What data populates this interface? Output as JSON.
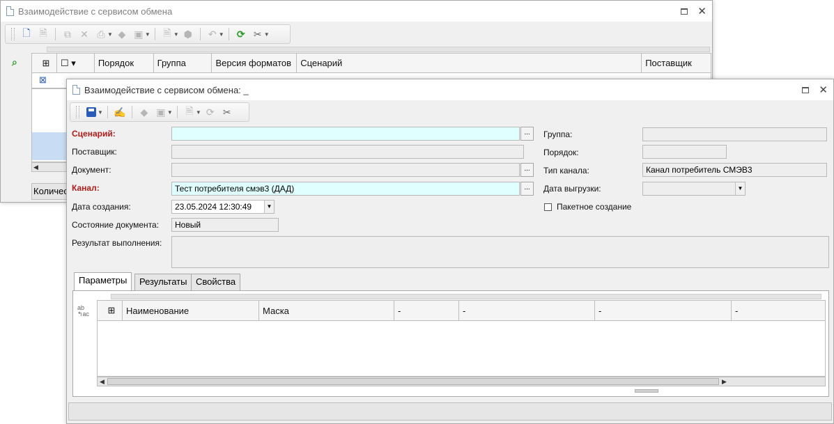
{
  "back_window": {
    "title": "Взаимодействие с сервисом обмена",
    "columns": [
      "Порядок",
      "Группа",
      "Версия форматов",
      "Сценарий",
      "Поставщик"
    ],
    "footer_label": "Количес"
  },
  "front_window": {
    "title": "Взаимодействие с сервисом обмена: _",
    "fields": {
      "scenario": {
        "label": "Сценарий:",
        "value": ""
      },
      "supplier": {
        "label": "Поставщик:",
        "value": ""
      },
      "document": {
        "label": "Документ:",
        "value": ""
      },
      "channel": {
        "label": "Канал:",
        "value": "Тест потребителя смэв3 (ДАД)"
      },
      "created": {
        "label": "Дата создания:",
        "value": "23.05.2024 12:30:49"
      },
      "doc_state": {
        "label": "Состояние документа:",
        "value": "Новый"
      },
      "result": {
        "label": "Результат выполнения:",
        "value": ""
      },
      "group": {
        "label": "Группа:",
        "value": ""
      },
      "order": {
        "label": "Порядок:",
        "value": ""
      },
      "channel_type": {
        "label": "Тип канала:",
        "value": "Канал потребитель СМЭВ3"
      },
      "upload_date": {
        "label": "Дата выгрузки:",
        "value": ""
      },
      "batch": {
        "label": "Пакетное создание",
        "checked": false
      }
    },
    "tabs": [
      "Параметры",
      "Результаты",
      "Свойства"
    ],
    "active_tab": "Параметры",
    "param_columns": [
      "Наименование",
      "Маска",
      "-",
      "-",
      "-",
      "-"
    ],
    "ellipsis": "..."
  }
}
